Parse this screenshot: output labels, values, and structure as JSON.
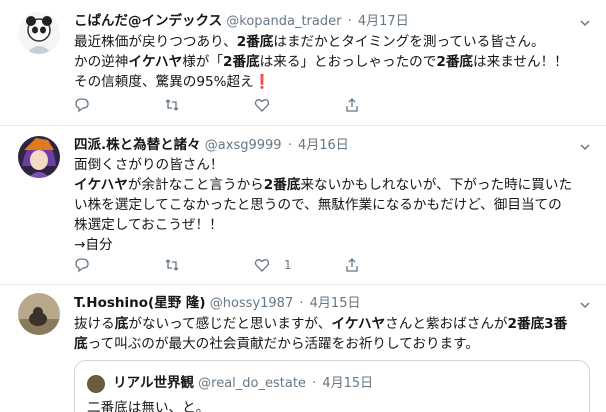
{
  "tweets": [
    {
      "name": "こぱんだ@インデックス",
      "handle": "@kopanda_trader",
      "sep": "·",
      "time": "4月17日",
      "lines": [
        "最近株価が戻りつつあり、2番底はまだかとタイミングを測っている皆さん。",
        "かの逆神イケハヤ様が「2番底は来る」とおっしゃったので2番底は来ません！！",
        "その信頼度、驚異の95%超え"
      ],
      "exclaim": "❗"
    },
    {
      "name": "四派.株と為替と諸々",
      "handle": "@axsg9999",
      "sep": "·",
      "time": "4月16日",
      "lines": [
        "面倒くさがりの皆さん！",
        "イケハヤが余計なこと言うから2番底来ないかもしれないが、下がった時に買いた",
        "い株を選定してこなかったと思うので、無駄作業になるかもだけど、御目当ての",
        "株選定しておこうぜ！！",
        "→自分"
      ],
      "like_count": "1"
    },
    {
      "name": "T.Hoshino(星野 隆)",
      "handle": "@hossy1987",
      "sep": "·",
      "time": "4月15日",
      "lines": [
        "抜ける底がないって感じだと思いますが、イケハヤさんと紫おばさんが2番底3番",
        "底って叫ぶのが最大の社会貢献だから活躍をお祈りしております。"
      ],
      "quote": {
        "name": "リアル世界観",
        "handle": "@real_do_estate",
        "sep": "·",
        "time": "4月15日",
        "text": "二番底は無い、と。"
      }
    }
  ],
  "colors": {
    "text": "#14171a",
    "muted": "#657786",
    "border": "#e6ecf0",
    "red": "#d8131f"
  },
  "icons": [
    "chevron-down-icon",
    "reply-icon",
    "retweet-icon",
    "like-icon",
    "share-icon"
  ]
}
